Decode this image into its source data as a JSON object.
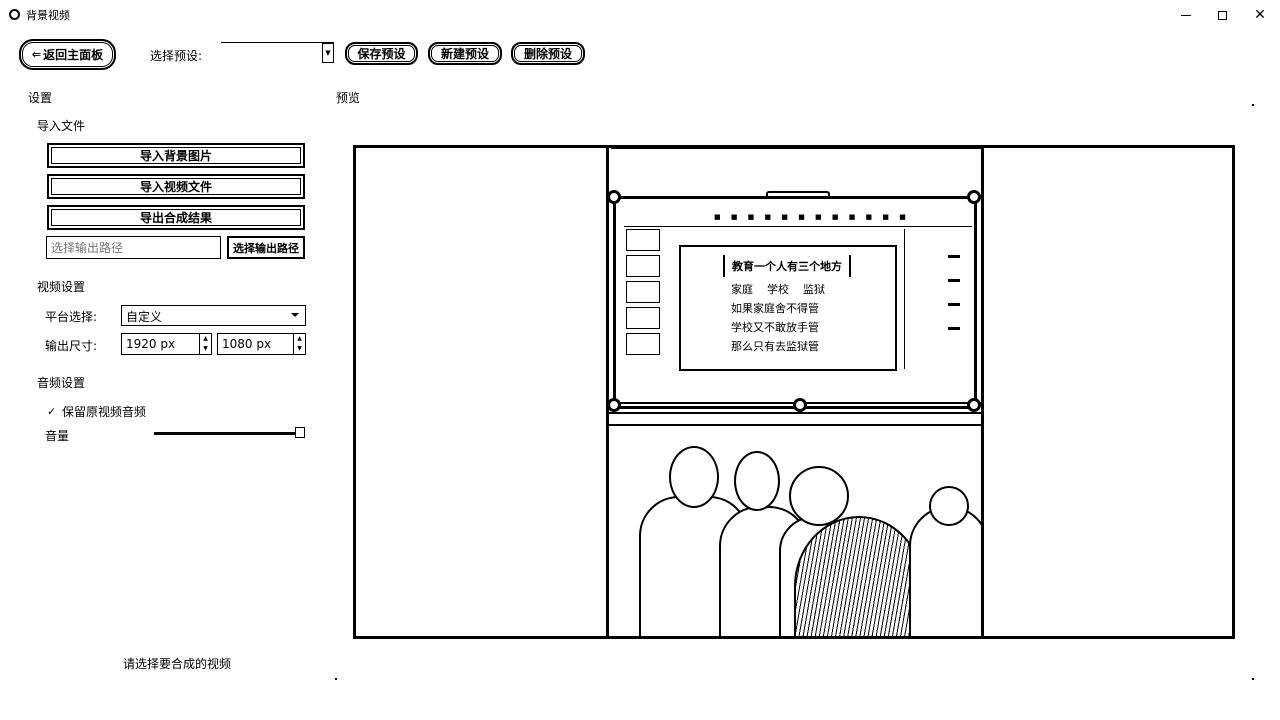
{
  "window": {
    "title": "背景视频"
  },
  "toolbar": {
    "back_label": "返回主面板",
    "preset_label": "选择预设:",
    "preset_value": "",
    "save_label": "保存预设",
    "new_label": "新建预设",
    "delete_label": "删除预设"
  },
  "settings": {
    "header": "设置",
    "import_section": "导入文件",
    "import_bg_label": "导入背景图片",
    "import_video_label": "导入视频文件",
    "export_label": "导出合成结果",
    "output_path_placeholder": "选择输出路径",
    "output_path_button": "选择输出路径",
    "video_section": "视频设置",
    "platform_label": "平台选择:",
    "platform_value": "自定义",
    "size_label": "输出尺寸:",
    "width_value": "1920 px",
    "height_value": "1080 px",
    "audio_section": "音频设置",
    "keep_audio_label": "保留原视频音频",
    "keep_audio_checked": true,
    "volume_label": "音量",
    "volume_level": 1.0
  },
  "preview": {
    "header": "预览",
    "slide_title": "教育一个人有三个地方",
    "slide_lines": [
      "家庭    学校    监狱",
      "如果家庭舍不得管",
      "学校又不敢放手管",
      "那么只有去监狱管"
    ]
  },
  "status": {
    "text": "请选择要合成的视频"
  },
  "icons": {
    "app": "app-icon",
    "back": "back-arrow-icon",
    "dropdown": "chevron-down-icon",
    "check": "checkmark-icon"
  }
}
